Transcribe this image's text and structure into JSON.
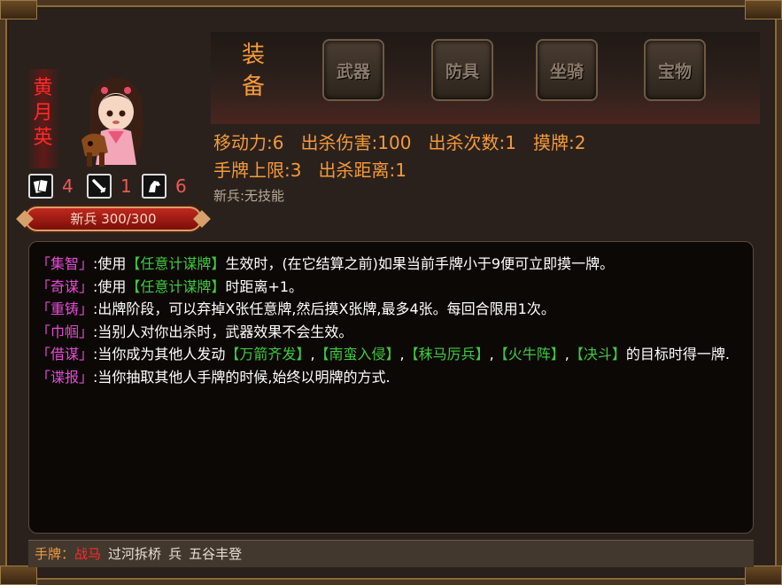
{
  "hero": {
    "name_lines": [
      "黄",
      "月",
      "英"
    ],
    "rank_hp_text": "新兵 300/300",
    "stats": [
      {
        "icon": "card-icon",
        "value": "4"
      },
      {
        "icon": "sword-icon",
        "value": "1"
      },
      {
        "icon": "horse-icon",
        "value": "6"
      }
    ]
  },
  "equipment": {
    "title_lines": [
      "装",
      "备"
    ],
    "slots": [
      "武器",
      "防具",
      "坐骑",
      "宝物"
    ]
  },
  "attributes": {
    "line1": "移动力:6   出杀伤害:100   出杀次数:1   摸牌:2",
    "line2": "手牌上限:3   出杀距离:1",
    "passive": "新兵:无技能"
  },
  "skills": [
    {
      "name": "「集智」",
      "parts": [
        {
          "t": ":使用"
        },
        {
          "t": "【任意计谋牌】",
          "ref": true
        },
        {
          "t": "生效时，(在它结算之前)如果当前手牌小于9便可立即摸一牌。"
        }
      ]
    },
    {
      "name": "「奇谋」",
      "parts": [
        {
          "t": ":使用"
        },
        {
          "t": "【任意计谋牌】",
          "ref": true
        },
        {
          "t": "时距离+1。"
        }
      ]
    },
    {
      "name": "「重铸」",
      "parts": [
        {
          "t": ":出牌阶段，可以弃掉X张任意牌,然后摸X张牌,最多4张。每回合限用1次。"
        }
      ]
    },
    {
      "name": "「巾帼」",
      "parts": [
        {
          "t": ":当别人对你出杀时，武器效果不会生效。"
        }
      ]
    },
    {
      "name": "「借谋」",
      "parts": [
        {
          "t": ":当你成为其他人发动"
        },
        {
          "t": "【万箭齐发】",
          "ref": true
        },
        {
          "t": ","
        },
        {
          "t": "【南蛮入侵】",
          "ref": true
        },
        {
          "t": ","
        },
        {
          "t": "【秣马厉兵】",
          "ref": true
        },
        {
          "t": ","
        },
        {
          "t": "【火牛阵】",
          "ref": true
        },
        {
          "t": ","
        },
        {
          "t": "【决斗】",
          "ref": true
        },
        {
          "t": "的目标时得一牌."
        }
      ]
    },
    {
      "name": "「谍报」",
      "parts": [
        {
          "t": ":当你抽取其他人手牌的时候,始终以明牌的方式."
        }
      ]
    }
  ],
  "hand": {
    "label": "手牌",
    "separator": "：",
    "cards": [
      {
        "name": "战马",
        "highlight": true
      },
      {
        "name": "过河拆桥",
        "highlight": false
      },
      {
        "name": "兵",
        "highlight": false
      },
      {
        "name": "五谷丰登",
        "highlight": false
      }
    ]
  }
}
